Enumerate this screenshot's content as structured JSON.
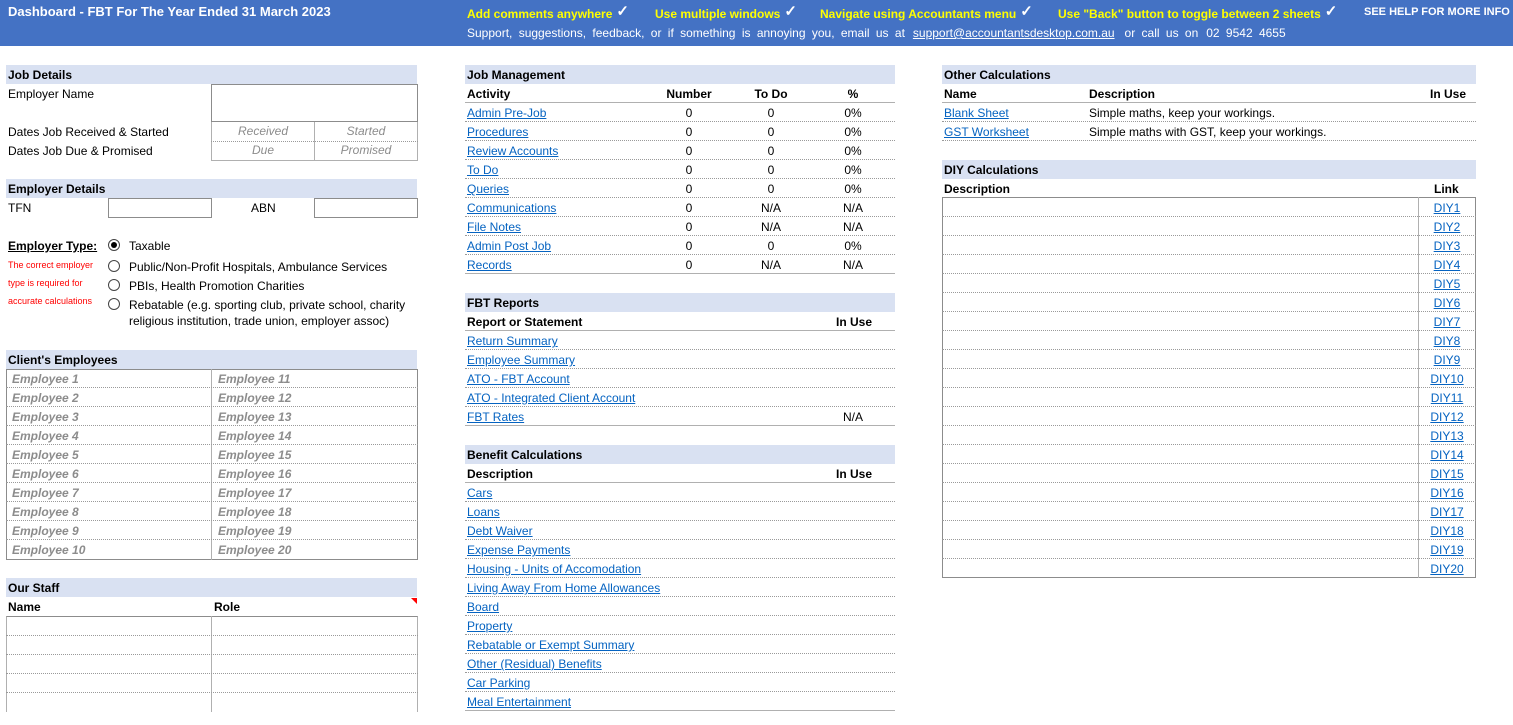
{
  "banner": {
    "title": "Dashboard - FBT For The Year Ended 31 March 2023",
    "tips": [
      "Add comments anywhere",
      "Use multiple windows",
      "Navigate using Accountants menu",
      "Use \"Back\" button to toggle between 2 sheets"
    ],
    "tick": "✓",
    "help": "SEE HELP FOR MORE INFO",
    "support_text": "Support,  suggestions,  feedback,   or if something is annoying you,   email us at",
    "email": "support@accountantsdesktop.com.au",
    "call_text": "or call us on",
    "phone": "02 9542 4655"
  },
  "job_details": {
    "header": "Job Details",
    "employer_name_label": "Employer Name",
    "dates_received_label": "Dates Job Received & Started",
    "dates_due_label": "Dates Job Due & Promised",
    "received_ph": "Received",
    "started_ph": "Started",
    "due_ph": "Due",
    "promised_ph": "Promised"
  },
  "employer_details": {
    "header": "Employer Details",
    "tfn_label": "TFN",
    "abn_label": "ABN",
    "type_label": "Employer Type:",
    "note_lines": [
      "The correct employer",
      "type is required for",
      "accurate calculations"
    ],
    "options": [
      "Taxable",
      "Public/Non-Profit Hospitals, Ambulance Services",
      "PBIs, Health Promotion Charities",
      "Rebatable (e.g. sporting club, private school, charity",
      "religious institution, trade union, employer assoc)"
    ],
    "selected_index": 0
  },
  "clients_employees": {
    "header": "Client's Employees",
    "left": [
      "Employee 1",
      "Employee 2",
      "Employee 3",
      "Employee 4",
      "Employee 5",
      "Employee 6",
      "Employee 7",
      "Employee 8",
      "Employee 9",
      "Employee 10"
    ],
    "right": [
      "Employee 11",
      "Employee 12",
      "Employee 13",
      "Employee 14",
      "Employee 15",
      "Employee 16",
      "Employee 17",
      "Employee 18",
      "Employee 19",
      "Employee 20"
    ]
  },
  "our_staff": {
    "header": "Our Staff",
    "col_name": "Name",
    "col_role": "Role"
  },
  "job_management": {
    "header": "Job Management",
    "cols": [
      "Activity",
      "Number",
      "To Do",
      "%"
    ],
    "rows": [
      {
        "activity": "Admin Pre-Job",
        "number": "0",
        "todo": "0",
        "pct": "0%"
      },
      {
        "activity": "Procedures",
        "number": "0",
        "todo": "0",
        "pct": "0%"
      },
      {
        "activity": "Review Accounts",
        "number": "0",
        "todo": "0",
        "pct": "0%"
      },
      {
        "activity": "To Do",
        "number": "0",
        "todo": "0",
        "pct": "0%"
      },
      {
        "activity": "Queries",
        "number": "0",
        "todo": "0",
        "pct": "0%"
      },
      {
        "activity": "Communications",
        "number": "0",
        "todo": "N/A",
        "pct": "N/A"
      },
      {
        "activity": "File Notes",
        "number": "0",
        "todo": "N/A",
        "pct": "N/A"
      },
      {
        "activity": "Admin Post Job",
        "number": "0",
        "todo": "0",
        "pct": "0%"
      },
      {
        "activity": "Records ",
        "number": "0",
        "todo": "N/A",
        "pct": "N/A"
      }
    ]
  },
  "fbt_reports": {
    "header": "FBT Reports",
    "col_report": "Report or Statement",
    "col_inuse": "In Use",
    "rows": [
      {
        "name": "Return Summary",
        "inuse": ""
      },
      {
        "name": "Employee Summary",
        "inuse": ""
      },
      {
        "name": "ATO - FBT Account",
        "inuse": ""
      },
      {
        "name": "ATO - Integrated Client Account",
        "inuse": ""
      },
      {
        "name": "FBT Rates",
        "inuse": "N/A"
      }
    ]
  },
  "benefit_calcs": {
    "header": "Benefit Calculations",
    "col_desc": "Description",
    "col_inuse": "In Use",
    "rows": [
      "Cars",
      "Loans",
      "Debt Waiver",
      "Expense Payments",
      "Housing - Units of Accomodation",
      "Living Away From Home Allowances",
      "Board",
      "Property",
      "Rebatable or Exempt Summary",
      "Other (Residual) Benefits",
      "Car Parking",
      "Meal Entertainment"
    ]
  },
  "other_calcs": {
    "header": "Other Calculations",
    "cols": [
      "Name",
      "Description",
      "In Use"
    ],
    "rows": [
      {
        "name": "Blank Sheet",
        "desc": "Simple maths, keep your workings."
      },
      {
        "name": "GST Worksheet",
        "desc": "Simple maths with GST, keep your workings."
      }
    ]
  },
  "diy_calcs": {
    "header": "DIY Calculations",
    "col_desc": "Description",
    "col_link": "Link",
    "links": [
      "DIY1",
      "DIY2",
      "DIY3",
      "DIY4",
      "DIY5",
      "DIY6",
      "DIY7",
      "DIY8",
      "DIY9",
      "DIY10",
      "DIY11",
      "DIY12",
      "DIY13",
      "DIY14",
      "DIY15",
      "DIY16",
      "DIY17",
      "DIY18",
      "DIY19",
      "DIY20"
    ]
  },
  "colors": {
    "banner": "#4472C4",
    "tip_yellow": "#FFFF00",
    "section_header": "#D9E1F2",
    "link": "#0563C1",
    "note_red": "#FF0000"
  }
}
